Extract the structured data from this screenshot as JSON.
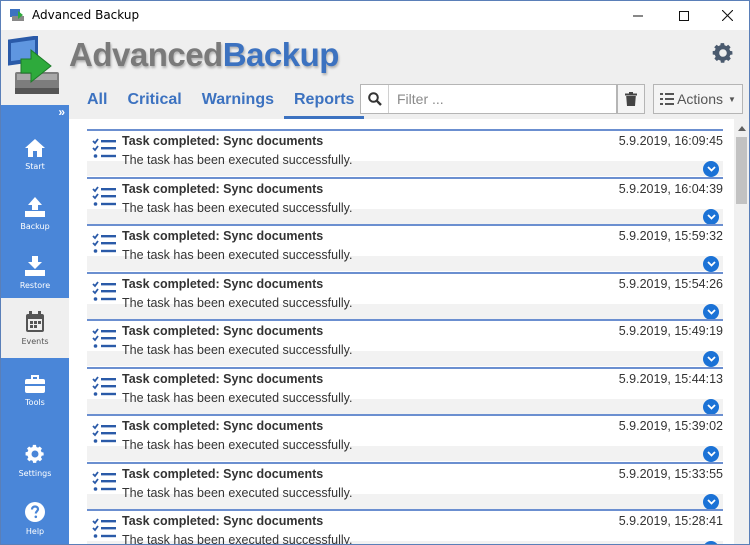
{
  "window": {
    "title": "Advanced Backup",
    "app_icon": "backup-app-icon"
  },
  "header": {
    "logo_part1": "Advanced",
    "logo_part2": "Backup",
    "settings_icon": "gear-icon"
  },
  "sidebar": {
    "collapse_glyph": "»",
    "items": [
      {
        "label": "Start",
        "icon": "home-icon",
        "active": false
      },
      {
        "label": "Backup",
        "icon": "upload-icon",
        "active": false
      },
      {
        "label": "Restore",
        "icon": "download-icon",
        "active": false
      },
      {
        "label": "Events",
        "icon": "calendar-icon",
        "active": true
      },
      {
        "label": "Tools",
        "icon": "toolbox-icon",
        "active": false
      },
      {
        "label": "Settings",
        "icon": "gear-icon",
        "active": false
      },
      {
        "label": "Help",
        "icon": "question-icon",
        "active": false
      }
    ]
  },
  "tabs": [
    {
      "label": "All",
      "active": false
    },
    {
      "label": "Critical",
      "active": false
    },
    {
      "label": "Warnings",
      "active": false
    },
    {
      "label": "Reports",
      "active": true
    }
  ],
  "filter": {
    "placeholder": "Filter ...",
    "value": ""
  },
  "toolbar": {
    "actions_label": "Actions"
  },
  "events": [
    {
      "title": "Task completed: Sync documents",
      "message": "The task has been executed successfully.",
      "time": "5.9.2019, 16:09:45"
    },
    {
      "title": "Task completed: Sync documents",
      "message": "The task has been executed successfully.",
      "time": "5.9.2019, 16:04:39"
    },
    {
      "title": "Task completed: Sync documents",
      "message": "The task has been executed successfully.",
      "time": "5.9.2019, 15:59:32"
    },
    {
      "title": "Task completed: Sync documents",
      "message": "The task has been executed successfully.",
      "time": "5.9.2019, 15:54:26"
    },
    {
      "title": "Task completed: Sync documents",
      "message": "The task has been executed successfully.",
      "time": "5.9.2019, 15:49:19"
    },
    {
      "title": "Task completed: Sync documents",
      "message": "The task has been executed successfully.",
      "time": "5.9.2019, 15:44:13"
    },
    {
      "title": "Task completed: Sync documents",
      "message": "The task has been executed successfully.",
      "time": "5.9.2019, 15:39:02"
    },
    {
      "title": "Task completed: Sync documents",
      "message": "The task has been executed successfully.",
      "time": "5.9.2019, 15:33:55"
    },
    {
      "title": "Task completed: Sync documents",
      "message": "The task has been executed successfully.",
      "time": "5.9.2019, 15:28:41"
    }
  ],
  "colors": {
    "accent": "#3c72c0",
    "sidebar": "#4a86d8",
    "expand_button": "#1b72d6"
  }
}
